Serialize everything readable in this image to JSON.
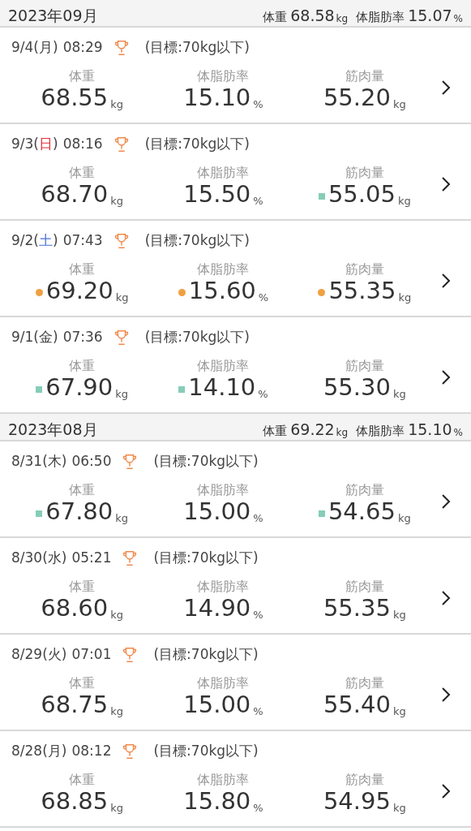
{
  "months": [
    {
      "title": "2023年09月",
      "summary": [
        {
          "label": "体重",
          "value": "68.58",
          "unit": "kg"
        },
        {
          "label": "体脂肪率",
          "value": "15.07",
          "unit": "%"
        }
      ],
      "entries": [
        {
          "date": "9/4(",
          "weekday": {
            "text": "月",
            "color": "#444444"
          },
          "date_close": ")",
          "time": "08:29",
          "goal": "(目標:70kg以下)",
          "measures": [
            {
              "label": "体重",
              "kind": "plain",
              "value": "68.55",
              "unit": "kg"
            },
            {
              "label": "体脂肪率",
              "kind": "plain",
              "value": "15.10",
              "unit": "%"
            },
            {
              "label": "筋肉量",
              "kind": "plain",
              "value": "55.20",
              "unit": "kg"
            }
          ]
        },
        {
          "date": "9/3(",
          "weekday": {
            "text": "日",
            "color": "#e0303a"
          },
          "date_close": ")",
          "time": "08:16",
          "goal": "(目標:70kg以下)",
          "measures": [
            {
              "label": "体重",
              "kind": "plain",
              "value": "68.70",
              "unit": "kg"
            },
            {
              "label": "体脂肪率",
              "kind": "plain",
              "value": "15.50",
              "unit": "%"
            },
            {
              "label": "筋肉量",
              "kind": "low",
              "value": "55.05",
              "unit": "kg"
            }
          ]
        },
        {
          "date": "9/2(",
          "weekday": {
            "text": "土",
            "color": "#4a72d8"
          },
          "date_close": ")",
          "time": "07:43",
          "goal": "(目標:70kg以下)",
          "measures": [
            {
              "label": "体重",
              "kind": "high",
              "value": "69.20",
              "unit": "kg"
            },
            {
              "label": "体脂肪率",
              "kind": "high",
              "value": "15.60",
              "unit": "%"
            },
            {
              "label": "筋肉量",
              "kind": "high",
              "value": "55.35",
              "unit": "kg"
            }
          ]
        },
        {
          "date": "9/1(",
          "weekday": {
            "text": "金",
            "color": "#444444"
          },
          "date_close": ")",
          "time": "07:36",
          "goal": "(目標:70kg以下)",
          "measures": [
            {
              "label": "体重",
              "kind": "low",
              "value": "67.90",
              "unit": "kg"
            },
            {
              "label": "体脂肪率",
              "kind": "low",
              "value": "14.10",
              "unit": "%"
            },
            {
              "label": "筋肉量",
              "kind": "plain",
              "value": "55.30",
              "unit": "kg"
            }
          ]
        }
      ]
    },
    {
      "title": "2023年08月",
      "summary": [
        {
          "label": "体重",
          "value": "69.22",
          "unit": "kg"
        },
        {
          "label": "体脂肪率",
          "value": "15.10",
          "unit": "%"
        }
      ],
      "entries": [
        {
          "date": "8/31(",
          "weekday": {
            "text": "木",
            "color": "#444444"
          },
          "date_close": ")",
          "time": "06:50",
          "goal": "(目標:70kg以下)",
          "measures": [
            {
              "label": "体重",
              "kind": "low",
              "value": "67.80",
              "unit": "kg"
            },
            {
              "label": "体脂肪率",
              "kind": "plain",
              "value": "15.00",
              "unit": "%"
            },
            {
              "label": "筋肉量",
              "kind": "low",
              "value": "54.65",
              "unit": "kg"
            }
          ]
        },
        {
          "date": "8/30(",
          "weekday": {
            "text": "水",
            "color": "#444444"
          },
          "date_close": ")",
          "time": "05:21",
          "goal": "(目標:70kg以下)",
          "measures": [
            {
              "label": "体重",
              "kind": "plain",
              "value": "68.60",
              "unit": "kg"
            },
            {
              "label": "体脂肪率",
              "kind": "plain",
              "value": "14.90",
              "unit": "%"
            },
            {
              "label": "筋肉量",
              "kind": "plain",
              "value": "55.35",
              "unit": "kg"
            }
          ]
        },
        {
          "date": "8/29(",
          "weekday": {
            "text": "火",
            "color": "#444444"
          },
          "date_close": ")",
          "time": "07:01",
          "goal": "(目標:70kg以下)",
          "measures": [
            {
              "label": "体重",
              "kind": "plain",
              "value": "68.75",
              "unit": "kg"
            },
            {
              "label": "体脂肪率",
              "kind": "plain",
              "value": "15.00",
              "unit": "%"
            },
            {
              "label": "筋肉量",
              "kind": "plain",
              "value": "55.40",
              "unit": "kg"
            }
          ]
        },
        {
          "date": "8/28(",
          "weekday": {
            "text": "月",
            "color": "#444444"
          },
          "date_close": ")",
          "time": "08:12",
          "goal": "(目標:70kg以下)",
          "measures": [
            {
              "label": "体重",
              "kind": "plain",
              "value": "68.85",
              "unit": "kg"
            },
            {
              "label": "体脂肪率",
              "kind": "plain",
              "value": "15.80",
              "unit": "%"
            },
            {
              "label": "筋肉量",
              "kind": "plain",
              "value": "54.95",
              "unit": "kg"
            }
          ]
        }
      ]
    }
  ]
}
